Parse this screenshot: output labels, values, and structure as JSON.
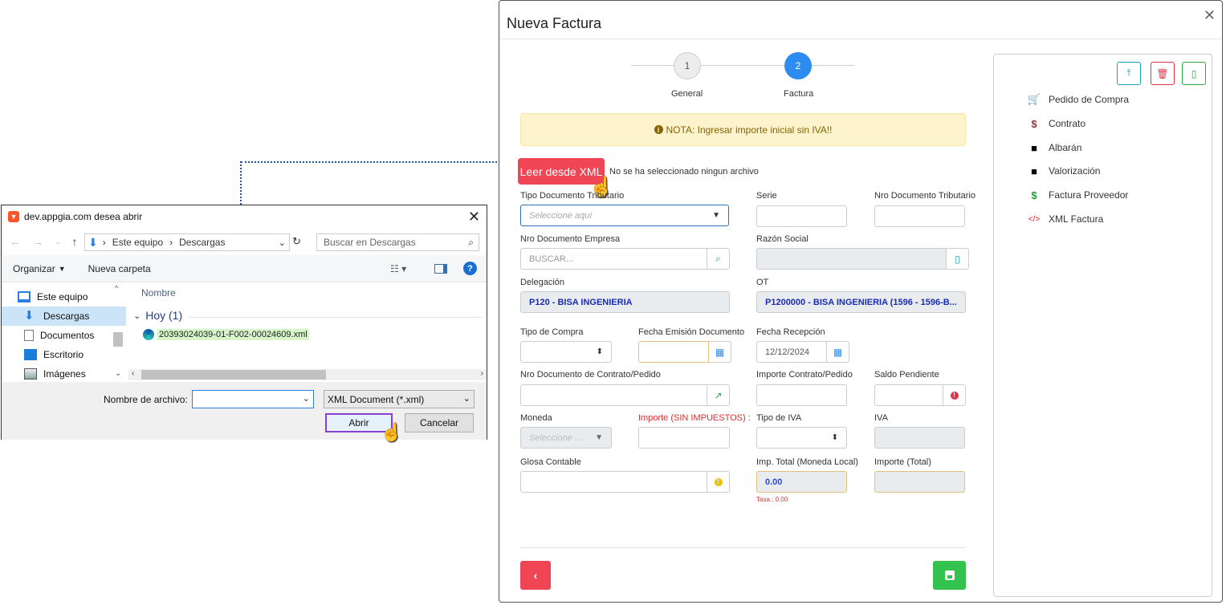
{
  "dialog": {
    "title": "dev.appgia.com desea abrir",
    "address": [
      "Este equipo",
      "Descargas"
    ],
    "search_placeholder": "Buscar en Descargas",
    "organize_label": "Organizar",
    "new_folder_label": "Nueva carpeta",
    "left_items": [
      "Este equipo",
      "Descargas",
      "Documentos",
      "Escritorio",
      "Imágenes"
    ],
    "column_name": "Nombre",
    "group_label": "Hoy (1)",
    "file_name": "20393024039-01-F002-00024609.xml",
    "filename_label": "Nombre de archivo:",
    "filename_value": "",
    "filter_value": "XML Document (*.xml)",
    "open_label": "Abrir",
    "cancel_label": "Cancelar"
  },
  "modal": {
    "title": "Nueva Factura",
    "steps": [
      {
        "num": "1",
        "label": "General"
      },
      {
        "num": "2",
        "label": "Factura"
      }
    ],
    "note": "NOTA: Ingresar importe inicial sin IVA!!",
    "xml_button": "Leer desde XML",
    "no_file": "No se ha seleccionado ningun archivo",
    "fields": {
      "tipo_doc_label": "Tipo Documento Tributario",
      "tipo_doc_placeholder": "Seleccione aquí",
      "serie_label": "Serie",
      "nro_doc_trib_label": "Nro Documento Tributario",
      "nro_doc_emp_label": "Nro Documento Empresa",
      "nro_doc_emp_placeholder": "BUSCAR...",
      "razon_label": "Razón Social",
      "delegacion_label": "Delegación",
      "delegacion_value": "P120 - BISA INGENIERIA",
      "ot_label": "OT",
      "ot_value": "P1200000 - BISA INGENIERIA (1596 - 1596-B...",
      "tipo_compra_label": "Tipo de Compra",
      "fecha_emision_label": "Fecha Emisión Documento",
      "fecha_recepcion_label": "Fecha Recepción",
      "fecha_recepcion_value": "12/12/2024",
      "nro_contrato_label": "Nro Documento de Contrato/Pedido",
      "importe_contrato_label": "Importe Contrato/Pedido",
      "saldo_label": "Saldo Pendiente",
      "moneda_label": "Moneda",
      "moneda_placeholder": "Seleccione ...",
      "importe_label": "Importe (SIN IMPUESTOS) :",
      "tipo_iva_label": "Tipo de IVA",
      "iva_label": "IVA",
      "glosa_label": "Glosa Contable",
      "imp_total_local_label": "Imp. Total (Moneda Local)",
      "imp_total_local_value": "0.00",
      "tasa_label": "Tasa.: 0.00",
      "importe_total_label": "Importe (Total)"
    },
    "side_items": [
      "Pedido de Compra",
      "Contrato",
      "Albarán",
      "Valorización",
      "Factura Proveedor",
      "XML Factura"
    ]
  },
  "colors": {
    "accent": "#2d8cf0",
    "danger": "#ef4555",
    "success": "#33c24d",
    "info": "#17a2b8",
    "warning_bg": "#fdf3cd"
  }
}
